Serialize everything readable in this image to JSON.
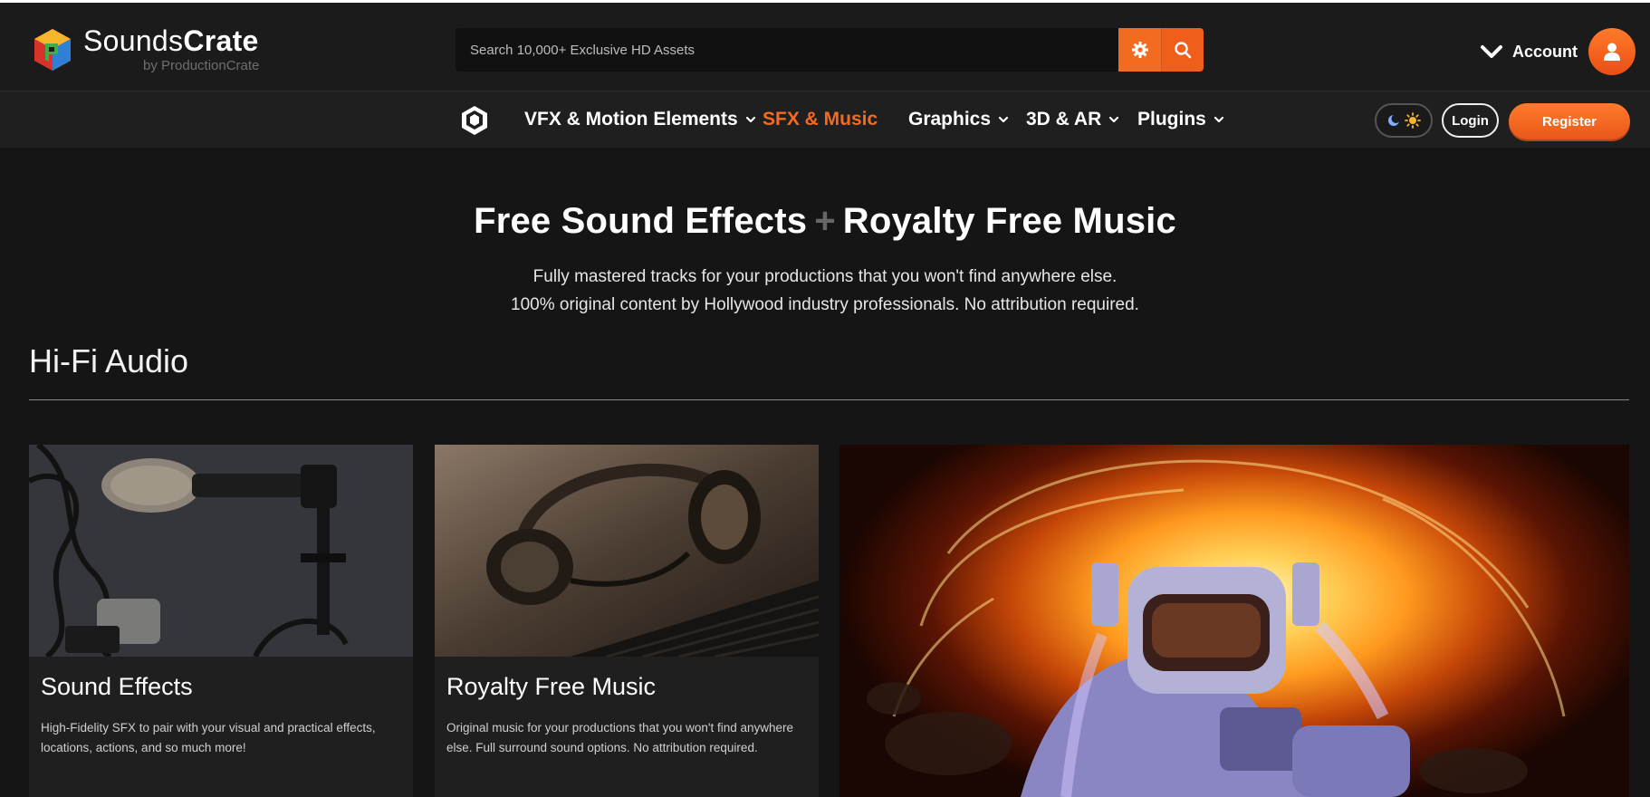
{
  "header": {
    "logo": {
      "name_part1": "Sounds",
      "name_part2": "Crate",
      "byline": "by ProductionCrate"
    },
    "search": {
      "placeholder": "Search 10,000+ Exclusive HD Assets",
      "value": ""
    },
    "account_label": "Account"
  },
  "nav": {
    "items": [
      {
        "label": "VFX & Motion Elements",
        "has_dropdown": true,
        "active": false
      },
      {
        "label": "SFX & Music",
        "has_dropdown": false,
        "active": true
      },
      {
        "label": "Graphics",
        "has_dropdown": true,
        "active": false
      },
      {
        "label": "3D & AR",
        "has_dropdown": true,
        "active": false
      },
      {
        "label": "Plugins",
        "has_dropdown": true,
        "active": false
      }
    ],
    "login_label": "Login",
    "register_label": "Register"
  },
  "hero": {
    "title_left": "Free Sound Effects",
    "title_plus": "+",
    "title_right": "Royalty Free Music",
    "subtitle_line1": "Fully mastered tracks for your productions that you won't find anywhere else.",
    "subtitle_line2": "100% original content by Hollywood industry professionals. No attribution required."
  },
  "section": {
    "title": "Hi-Fi Audio",
    "cards": [
      {
        "title": "Sound Effects",
        "description": "High-Fidelity SFX to pair with your visual and practical effects, locations, actions, and so much more!"
      },
      {
        "title": "Royalty Free Music",
        "description": "Original music for your productions that you won't find anywhere else. Full surround sound options. No attribution required."
      }
    ]
  },
  "colors": {
    "accent": "#f26b21",
    "background": "#151515",
    "header": "#1b1b1b",
    "card": "#1f1f1f"
  },
  "icons": [
    "soundscrate-logo-icon",
    "gear-icon",
    "search-icon",
    "chevron-down-icon",
    "user-icon",
    "productioncrate-cube-icon",
    "moon-icon",
    "sun-icon"
  ]
}
